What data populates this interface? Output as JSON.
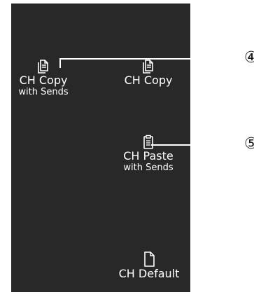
{
  "buttons": {
    "ch_copy_with_sends": {
      "label": "CH Copy",
      "sublabel": "with Sends",
      "icon": "copy-icon"
    },
    "ch_copy": {
      "label": "CH Copy",
      "icon": "copy-icon"
    },
    "ch_paste_with_sends": {
      "label": "CH Paste",
      "sublabel": "with Sends",
      "icon": "clipboard-icon"
    },
    "ch_default": {
      "label": "CH Default",
      "icon": "document-icon"
    }
  },
  "callouts": [
    {
      "number": "④"
    },
    {
      "number": "⑤"
    }
  ],
  "colors": {
    "panel": "#282828",
    "text": "#ffffff",
    "callout": "#1a1a1a"
  }
}
